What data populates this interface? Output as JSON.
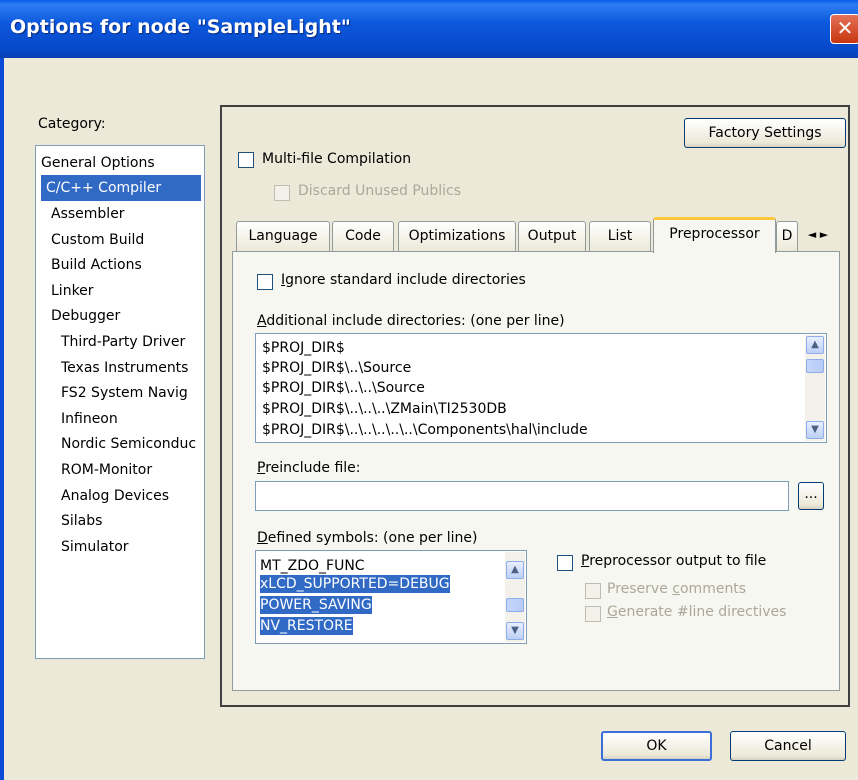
{
  "window": {
    "title": "Options for node \"SampleLight\"",
    "close_glyph": "✕"
  },
  "category": {
    "label": "Category:",
    "items": [
      {
        "label": "General Options"
      },
      {
        "label": "C/C++ Compiler",
        "selected": true
      },
      {
        "label": "Assembler"
      },
      {
        "label": "Custom Build"
      },
      {
        "label": "Build Actions"
      },
      {
        "label": "Linker"
      },
      {
        "label": "Debugger"
      },
      {
        "label": "Third-Party Driver"
      },
      {
        "label": "Texas Instruments"
      },
      {
        "label": "FS2 System Navig"
      },
      {
        "label": "Infineon"
      },
      {
        "label": "Nordic Semiconduc"
      },
      {
        "label": "ROM-Monitor"
      },
      {
        "label": "Analog Devices"
      },
      {
        "label": "Silabs"
      },
      {
        "label": "Simulator"
      }
    ]
  },
  "panel": {
    "factory_settings": "Factory Settings",
    "multi_file": {
      "label": "Multi-file Compilation",
      "checked": false
    },
    "discard_unused": {
      "label": "Discard Unused Publics",
      "checked": false,
      "enabled": false
    },
    "tabs": [
      {
        "label": "Language"
      },
      {
        "label": "Code"
      },
      {
        "label": "Optimizations"
      },
      {
        "label": "Output"
      },
      {
        "label": "List"
      },
      {
        "label": "Preprocessor",
        "active": true
      },
      {
        "label": "D"
      }
    ],
    "tab_scroll": {
      "left": "◄",
      "right": "►"
    }
  },
  "preprocessor": {
    "ignore_std": {
      "label_prefix": "I",
      "label_rest": "gnore standard include directories",
      "checked": false
    },
    "include_dirs_label": {
      "prefix": "A",
      "rest": "dditional include directories: (one per line)"
    },
    "include_dirs": [
      "$PROJ_DIR$",
      "$PROJ_DIR$\\..\\Source",
      "$PROJ_DIR$\\..\\..\\Source",
      "$PROJ_DIR$\\..\\..\\..\\ZMain\\TI2530DB",
      "$PROJ_DIR$\\..\\..\\..\\..\\..\\Components\\hal\\include"
    ],
    "preinclude_label": {
      "prefix": "P",
      "rest": "reinclude file:"
    },
    "preinclude_value": "",
    "browse_label": "...",
    "defined_label": {
      "prefix": "D",
      "rest": "efined symbols: (one per line)"
    },
    "defined_symbols": [
      {
        "text": "MT_ZDO_FUNC",
        "selected": false
      },
      {
        "text": "xLCD_SUPPORTED=DEBUG",
        "selected": true
      },
      {
        "text": "POWER_SAVING",
        "selected": true
      },
      {
        "text": "NV_RESTORE",
        "selected": true
      }
    ],
    "pp_output": {
      "label_prefix": "P",
      "label_rest": "reprocessor output to file",
      "checked": false
    },
    "preserve_comments": {
      "label_pre": "Preserve ",
      "label_u": "c",
      "label_post": "omments",
      "enabled": false
    },
    "generate_line": {
      "label_u": "G",
      "label_rest": "enerate #line directives",
      "enabled": false
    }
  },
  "footer": {
    "ok": "OK",
    "cancel": "Cancel"
  },
  "scroll_glyphs": {
    "up": "▲",
    "down": "▼"
  }
}
